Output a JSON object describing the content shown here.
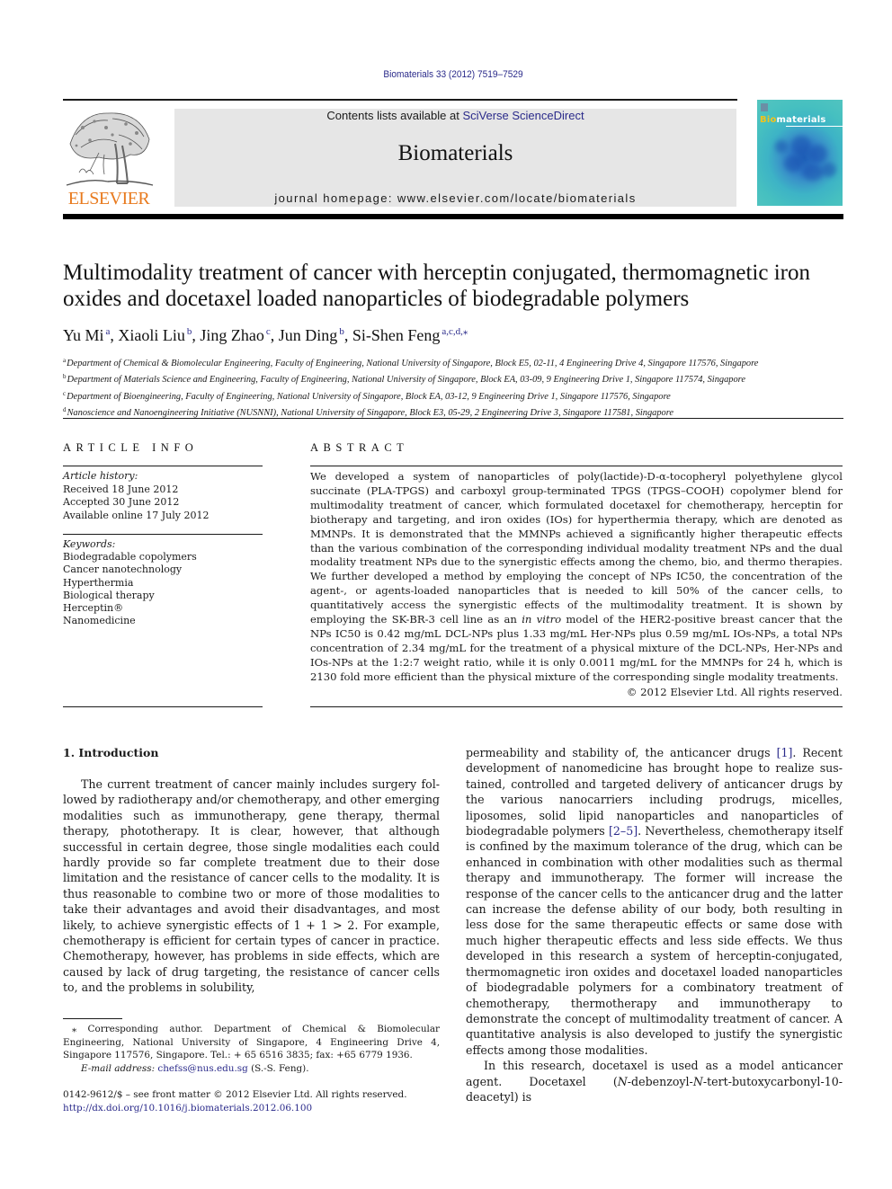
{
  "header": {
    "citation": "Biomaterials 33 (2012) 7519–7529",
    "contents_prefix": "Contents lists available at ",
    "contents_link": "SciVerse ScienceDirect",
    "journal_name": "Biomaterials",
    "homepage": "journal homepage: www.elsevier.com/locate/biomaterials",
    "publisher_logo": "ELSEVIER",
    "cover_title_prefix": "Bio",
    "cover_title_suffix": "materials",
    "colors": {
      "publisher_orange": "#e87a1e",
      "link_blue": "#2a2a8a",
      "masthead_grey": "#e6e6e6",
      "cover_teal": "#46c0c0"
    }
  },
  "article": {
    "title": "Multimodality treatment of cancer with herceptin conjugated, thermomagnetic iron oxides and docetaxel loaded nanoparticles of biodegradable polymers",
    "authors": [
      {
        "name": "Yu Mi",
        "sup": "a",
        "sep": ", "
      },
      {
        "name": "Xiaoli Liu",
        "sup": "b",
        "sep": ", "
      },
      {
        "name": "Jing Zhao",
        "sup": "c",
        "sep": ", "
      },
      {
        "name": "Jun Ding",
        "sup": "b",
        "sep": ", "
      },
      {
        "name": "Si-Shen Feng",
        "sup": "a,c,d,⁎",
        "sep": ""
      }
    ],
    "affiliations": [
      {
        "key": "a",
        "text": "Department of Chemical & Biomolecular Engineering, Faculty of Engineering, National University of Singapore, Block E5, 02-11, 4 Engineering Drive 4, Singapore 117576, Singapore"
      },
      {
        "key": "b",
        "text": "Department of Materials Science and Engineering, Faculty of Engineering, National University of Singapore, Block EA, 03-09, 9 Engineering Drive 1, Singapore 117574, Singapore"
      },
      {
        "key": "c",
        "text": "Department of Bioengineering, Faculty of Engineering, National University of Singapore, Block EA, 03-12, 9 Engineering Drive 1, Singapore 117576, Singapore"
      },
      {
        "key": "d",
        "text": "Nanoscience and Nanoengineering Initiative (NUSNNI), National University of Singapore, Block E3, 05-29, 2 Engineering Drive 3, Singapore 117581, Singapore"
      }
    ]
  },
  "article_info": {
    "heading": "ARTICLE INFO",
    "history_label": "Article history:",
    "history": [
      "Received 18 June 2012",
      "Accepted 30 June 2012",
      "Available online 17 July 2012"
    ],
    "keywords_label": "Keywords:",
    "keywords": [
      "Biodegradable copolymers",
      "Cancer nanotechnology",
      "Hyperthermia",
      "Biological therapy",
      "Herceptin®",
      "Nanomedicine"
    ]
  },
  "abstract": {
    "heading": "ABSTRACT",
    "text_1": "We developed a system of nanoparticles of poly(lactide)-D-α-tocopheryl polyethylene glycol succinate (PLA-TPGS) and carboxyl group-terminated TPGS (TPGS–COOH) copolymer blend for multimodality treatment of cancer, which formulated docetaxel for chemotherapy, herceptin for biotherapy and tar­geting, and iron oxides (IOs) for hyperthermia therapy, which are denoted as MMNPs. It is demonstrated that the MMNPs achieved a significantly higher therapeutic effects than the various combination of the corresponding individual modality treatment NPs and the dual modality treatment NPs due to the synergistic effects among the chemo, bio, and thermo therapies. We further developed a method by employing the concept of NPs IC50, the concentration of the agent-, or agents-loaded nanoparticles that is needed to kill 50% of the cancer cells, to quantitatively access the synergistic effects of the multi­modality treatment. It is shown by employing the SK-BR-3 cell line as an ",
    "text_italic": "in vitro",
    "text_2": " model of the HER2-positive breast cancer that the NPs IC50 is 0.42 mg/mL DCL-NPs plus 1.33 mg/mL Her-NPs plus 0.59 mg/mL IOs-NPs, a total NPs concentration of 2.34 mg/mL for the treatment of a physical mixture of the DCL-NPs, Her-NPs and IOs-NPs at the 1:2:7 weight ratio, while it is only 0.0011 mg/mL for the MMNPs for 24 h, which is 2130 fold more efficient than the physical mixture of the corresponding single modality treatments.",
    "copyright": "© 2012 Elsevier Ltd. All rights reserved."
  },
  "body": {
    "section_heading": "1.  Introduction",
    "left_paragraph": "The current treatment of cancer mainly includes surgery fol­lowed by radiotherapy and/or chemotherapy, and other emerging modalities such as immunotherapy, gene therapy, thermal therapy, phototherapy. It is clear, however, that although successful in certain degree, those single modalities each could hardly provide so far complete treatment due to their dose limitation and the resis­tance of cancer cells to the modality. It is thus reasonable to combine two or more of those modalities to take their advantages and avoid their disadvantages, and most likely, to achieve syner­gistic effects of 1 + 1 > 2. For example, chemotherapy is efficient for certain types of cancer in practice. Chemotherapy, however, has problems in side effects, which are caused by lack of drug targeting, the resistance of cancer cells to, and the problems in solubility,",
    "right_p1_a": "permeability and stability of, the anticancer drugs ",
    "ref_1": "[1]",
    "right_p1_b": ". Recent development of nanomedicine has brought hope to realize sus­tained, controlled and targeted delivery of anticancer drugs by the various nanocarriers including prodrugs, micelles, liposomes, solid lipid nanoparticles and nanoparticles of biodegradable polymers ",
    "ref_2": "[2–5]",
    "right_p1_c": ". Nevertheless, chemotherapy itself is confined by the maximum tolerance of the drug, which can be enhanced in combination with other modalities such as thermal therapy and immunotherapy. The former will increase the response of the cancer cells to the anticancer drug and the latter can increase the defense ability of our body, both resulting in less dose for the same therapeutic effects or same dose with much higher therapeutic effects and less side effects. We thus developed in this research a system of herceptin-conjugated, thermomagnetic iron oxides and docetaxel loaded nanoparticles of biodegradable polymers for a combinatory treatment of chemotherapy, thermotherapy and immunotherapy to demonstrate the concept of multimodality treatment of cancer. A quantitative analysis is also developed to justify the synergistic effects among those modalities.",
    "right_p2_a": "In this research, docetaxel is used as a model anticancer agent. Docetaxel (",
    "right_p2_n1": "N",
    "right_p2_b": "-debenzoyl-",
    "right_p2_n2": "N",
    "right_p2_c": "-tert-butoxycarbonyl-10-deacetyl) is"
  },
  "footnote": {
    "corresponding": "⁎ Corresponding author. Department of Chemical & Biomolecular Engineering, National University of Singapore, 4 Engineering Drive 4, Singapore 117576, Singapore. Tel.: + 65 6516 3835; fax: +65 6779 1936.",
    "email_label": "E-mail address:",
    "email": "chefss@nus.edu.sg",
    "email_owner": " (S.-S. Feng).",
    "front_matter": "0142-9612/$ – see front matter © 2012 Elsevier Ltd. All rights reserved.",
    "doi": "http://dx.doi.org/10.1016/j.biomaterials.2012.06.100"
  }
}
